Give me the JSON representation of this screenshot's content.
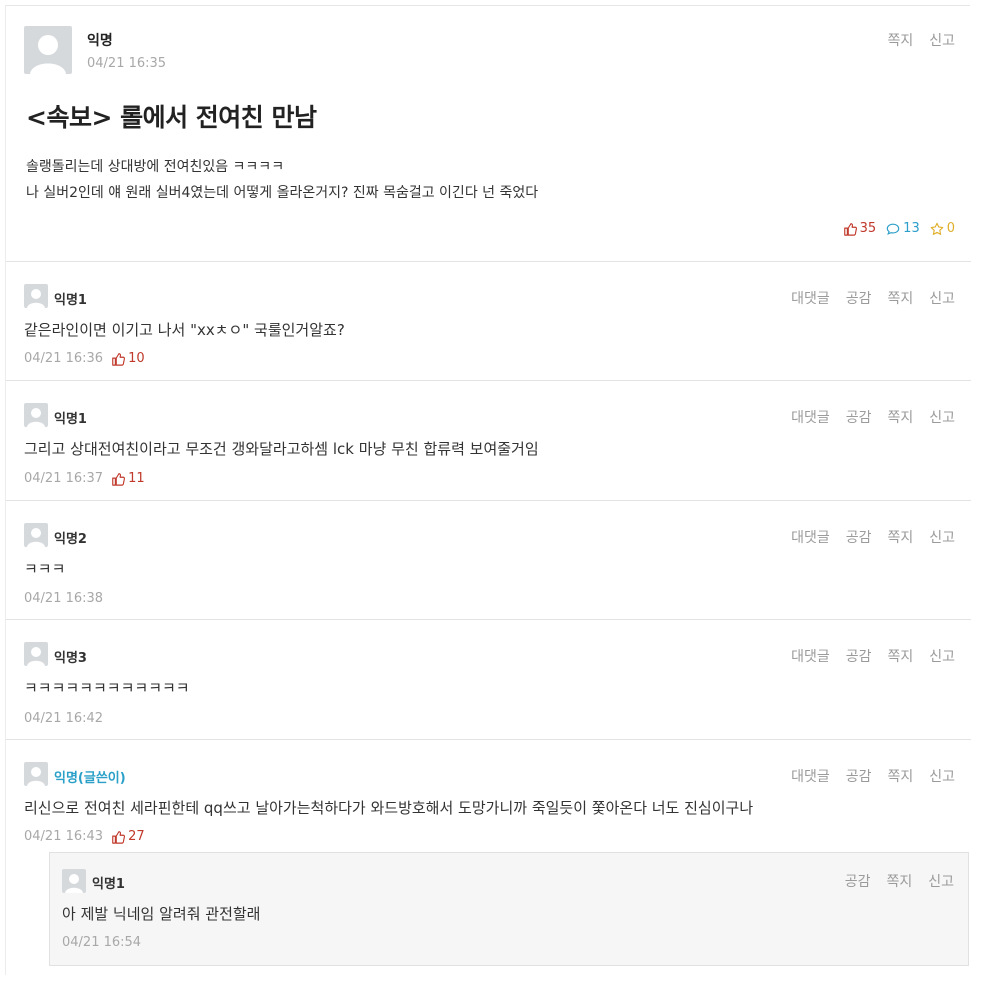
{
  "post": {
    "author": "익명",
    "time": "04/21 16:35",
    "actions": [
      "쪽지",
      "신고"
    ],
    "title": "<속보> 롤에서 전여친 만남",
    "body_lines": [
      "솔랭돌리는데 상대방에 전여친있음 ㅋㅋㅋㅋ",
      "나 실버2인데 얘 원래 실버4였는데 어떻게 올라온거지? 진짜 목숨걸고 이긴다 넌 죽었다"
    ],
    "likes": "35",
    "comments": "13",
    "scraps": "0"
  },
  "comments": [
    {
      "author": "익명1",
      "actions": [
        "대댓글",
        "공감",
        "쪽지",
        "신고"
      ],
      "text": "같은라인이면 이기고 나서 \"xxㅊㅇ\" 국룰인거알죠?",
      "time": "04/21 16:36",
      "likes": "10"
    },
    {
      "author": "익명1",
      "actions": [
        "대댓글",
        "공감",
        "쪽지",
        "신고"
      ],
      "text": "그리고 상대전여친이라고 무조건 갱와달라고하셈 lck 마냥 무친 합류력 보여줄거임",
      "time": "04/21 16:37",
      "likes": "11"
    },
    {
      "author": "익명2",
      "actions": [
        "대댓글",
        "공감",
        "쪽지",
        "신고"
      ],
      "text": "ㅋㅋㅋ",
      "time": "04/21 16:38",
      "likes": ""
    },
    {
      "author": "익명3",
      "actions": [
        "대댓글",
        "공감",
        "쪽지",
        "신고"
      ],
      "text": "ㅋㅋㅋㅋㅋㅋㅋㅋㅋㅋㅋㅋ",
      "time": "04/21 16:42",
      "likes": ""
    },
    {
      "author": "익명(글쓴이)",
      "actions": [
        "대댓글",
        "공감",
        "쪽지",
        "신고"
      ],
      "text": "리신으로 전여친 세라핀한테 qq쓰고 날아가는척하다가 와드방호해서 도망가니까 죽일듯이 쫓아온다 너도 진심이구나",
      "time": "04/21 16:43",
      "likes": "27"
    }
  ],
  "reply": {
    "author": "익명1",
    "actions": [
      "공감",
      "쪽지",
      "신고"
    ],
    "text": "아 제발 닉네임 알려줘 관전할래",
    "time": "04/21 16:54"
  },
  "colors": {
    "like": "#c0392b",
    "comment": "#2b9ec9",
    "scrap": "#e0b02b",
    "op_author": "#2aa0c8"
  }
}
